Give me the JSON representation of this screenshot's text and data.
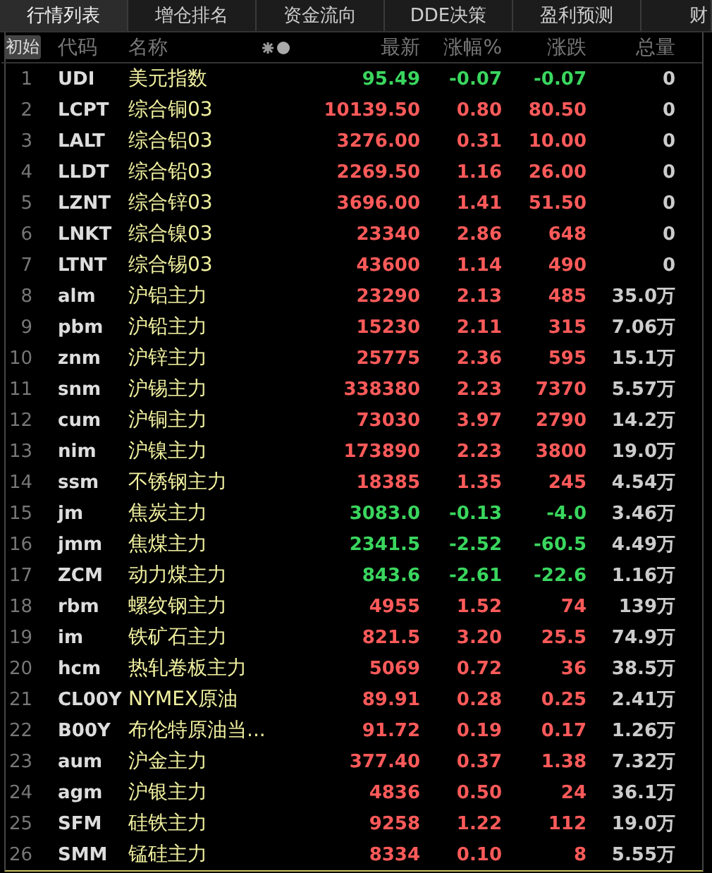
{
  "tabs": [
    {
      "label": "行情列表",
      "selected": true
    },
    {
      "label": "增仓排名",
      "selected": false
    },
    {
      "label": "资金流向",
      "selected": false
    },
    {
      "label": "DDE决策",
      "selected": false
    },
    {
      "label": "盈利预测",
      "selected": false
    },
    {
      "label": "财",
      "selected": false
    }
  ],
  "header": {
    "reset_button": "初始",
    "columns": [
      "代码",
      "名称",
      "最新",
      "涨幅%",
      "涨跌",
      "总量"
    ]
  },
  "rows": [
    {
      "no": "1",
      "code": "UDI",
      "name": "美元指数",
      "latest": "95.49",
      "pct": "-0.07",
      "change": "-0.07",
      "volume": "0",
      "color": "#3ad65e"
    },
    {
      "no": "2",
      "code": "LCPT",
      "name": "综合铜03",
      "latest": "10139.50",
      "pct": "0.80",
      "change": "80.50",
      "volume": "0",
      "color": "#ff5a5a"
    },
    {
      "no": "3",
      "code": "LALT",
      "name": "综合铝03",
      "latest": "3276.00",
      "pct": "0.31",
      "change": "10.00",
      "volume": "0",
      "color": "#ff5a5a"
    },
    {
      "no": "4",
      "code": "LLDT",
      "name": "综合铅03",
      "latest": "2269.50",
      "pct": "1.16",
      "change": "26.00",
      "volume": "0",
      "color": "#ff5a5a"
    },
    {
      "no": "5",
      "code": "LZNT",
      "name": "综合锌03",
      "latest": "3696.00",
      "pct": "1.41",
      "change": "51.50",
      "volume": "0",
      "color": "#ff5a5a"
    },
    {
      "no": "6",
      "code": "LNKT",
      "name": "综合镍03",
      "latest": "23340",
      "pct": "2.86",
      "change": "648",
      "volume": "0",
      "color": "#ff5a5a"
    },
    {
      "no": "7",
      "code": "LTNT",
      "name": "综合锡03",
      "latest": "43600",
      "pct": "1.14",
      "change": "490",
      "volume": "0",
      "color": "#ff5a5a"
    },
    {
      "no": "8",
      "code": "alm",
      "name": "沪铝主力",
      "latest": "23290",
      "pct": "2.13",
      "change": "485",
      "volume": "35.0万",
      "color": "#ff5a5a"
    },
    {
      "no": "9",
      "code": "pbm",
      "name": "沪铅主力",
      "latest": "15230",
      "pct": "2.11",
      "change": "315",
      "volume": "7.06万",
      "color": "#ff5a5a"
    },
    {
      "no": "10",
      "code": "znm",
      "name": "沪锌主力",
      "latest": "25775",
      "pct": "2.36",
      "change": "595",
      "volume": "15.1万",
      "color": "#ff5a5a"
    },
    {
      "no": "11",
      "code": "snm",
      "name": "沪锡主力",
      "latest": "338380",
      "pct": "2.23",
      "change": "7370",
      "volume": "5.57万",
      "color": "#ff5a5a"
    },
    {
      "no": "12",
      "code": "cum",
      "name": "沪铜主力",
      "latest": "73030",
      "pct": "3.97",
      "change": "2790",
      "volume": "14.2万",
      "color": "#ff5a5a"
    },
    {
      "no": "13",
      "code": "nim",
      "name": "沪镍主力",
      "latest": "173890",
      "pct": "2.23",
      "change": "3800",
      "volume": "19.0万",
      "color": "#ff5a5a"
    },
    {
      "no": "14",
      "code": "ssm",
      "name": "不锈钢主力",
      "latest": "18385",
      "pct": "1.35",
      "change": "245",
      "volume": "4.54万",
      "color": "#ff5a5a"
    },
    {
      "no": "15",
      "code": "jm",
      "name": "焦炭主力",
      "latest": "3083.0",
      "pct": "-0.13",
      "change": "-4.0",
      "volume": "3.46万",
      "color": "#3ad65e"
    },
    {
      "no": "16",
      "code": "jmm",
      "name": "焦煤主力",
      "latest": "2341.5",
      "pct": "-2.52",
      "change": "-60.5",
      "volume": "4.49万",
      "color": "#3ad65e"
    },
    {
      "no": "17",
      "code": "ZCM",
      "name": "动力煤主力",
      "latest": "843.6",
      "pct": "-2.61",
      "change": "-22.6",
      "volume": "1.16万",
      "color": "#3ad65e"
    },
    {
      "no": "18",
      "code": "rbm",
      "name": "螺纹钢主力",
      "latest": "4955",
      "pct": "1.52",
      "change": "74",
      "volume": "139万",
      "color": "#ff5a5a"
    },
    {
      "no": "19",
      "code": "im",
      "name": "铁矿石主力",
      "latest": "821.5",
      "pct": "3.20",
      "change": "25.5",
      "volume": "74.9万",
      "color": "#ff5a5a"
    },
    {
      "no": "20",
      "code": "hcm",
      "name": "热轧卷板主力",
      "latest": "5069",
      "pct": "0.72",
      "change": "36",
      "volume": "38.5万",
      "color": "#ff5a5a"
    },
    {
      "no": "21",
      "code": "CL00Y",
      "name": "NYMEX原油",
      "latest": "89.91",
      "pct": "0.28",
      "change": "0.25",
      "volume": "2.41万",
      "color": "#ff5a5a"
    },
    {
      "no": "22",
      "code": "B00Y",
      "name": "布伦特原油当...",
      "latest": "91.72",
      "pct": "0.19",
      "change": "0.17",
      "volume": "1.26万",
      "color": "#ff5a5a"
    },
    {
      "no": "23",
      "code": "aum",
      "name": "沪金主力",
      "latest": "377.40",
      "pct": "0.37",
      "change": "1.38",
      "volume": "7.32万",
      "color": "#ff5a5a"
    },
    {
      "no": "24",
      "code": "agm",
      "name": "沪银主力",
      "latest": "4836",
      "pct": "0.50",
      "change": "24",
      "volume": "36.1万",
      "color": "#ff5a5a"
    },
    {
      "no": "25",
      "code": "SFM",
      "name": "硅铁主力",
      "latest": "9258",
      "pct": "1.22",
      "change": "112",
      "volume": "19.0万",
      "color": "#ff5a5a"
    },
    {
      "no": "26",
      "code": "SMM",
      "name": "锰硅主力",
      "latest": "8334",
      "pct": "0.10",
      "change": "8",
      "volume": "5.55万",
      "color": "#ff5a5a"
    }
  ]
}
